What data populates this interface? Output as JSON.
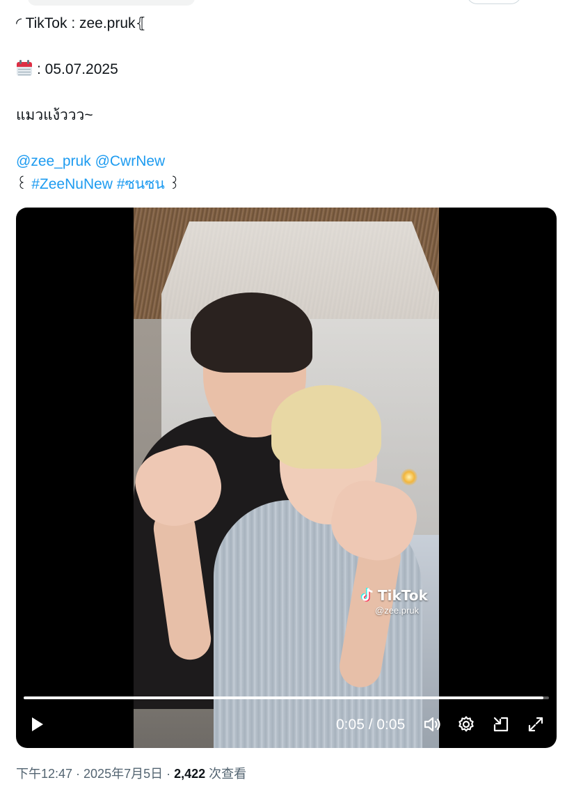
{
  "tweet": {
    "lines": {
      "source": "◜ TikTok : zee.pruk⦃",
      "date": ": 05.07.2025",
      "caption": "แมวแง้ววว~",
      "mention_1": "@zee_pruk",
      "mention_2": "@CwrNew",
      "brace_open": "꒰",
      "hashtag_1": "#ZeeNuNew",
      "hashtag_2": "#ซนซน",
      "brace_close": "꒱"
    },
    "date_icon": "calendar-icon"
  },
  "video": {
    "watermark_title": "TikTok",
    "watermark_handle": "@zee.pruk",
    "time_display": "0:05 / 0:05",
    "progress_fraction": 0.99,
    "controls": [
      "play-icon",
      "volume-icon",
      "settings-icon",
      "picture-in-picture-icon",
      "fullscreen-icon"
    ]
  },
  "footer": {
    "timestamp": "下午12:47 · 2025年7月5日 · ",
    "views_count": "2,422",
    "views_label": " 次查看"
  },
  "colors": {
    "link": "#1d9bf0",
    "text": "#0f1419",
    "muted": "#536471",
    "video_bg": "#000000"
  }
}
